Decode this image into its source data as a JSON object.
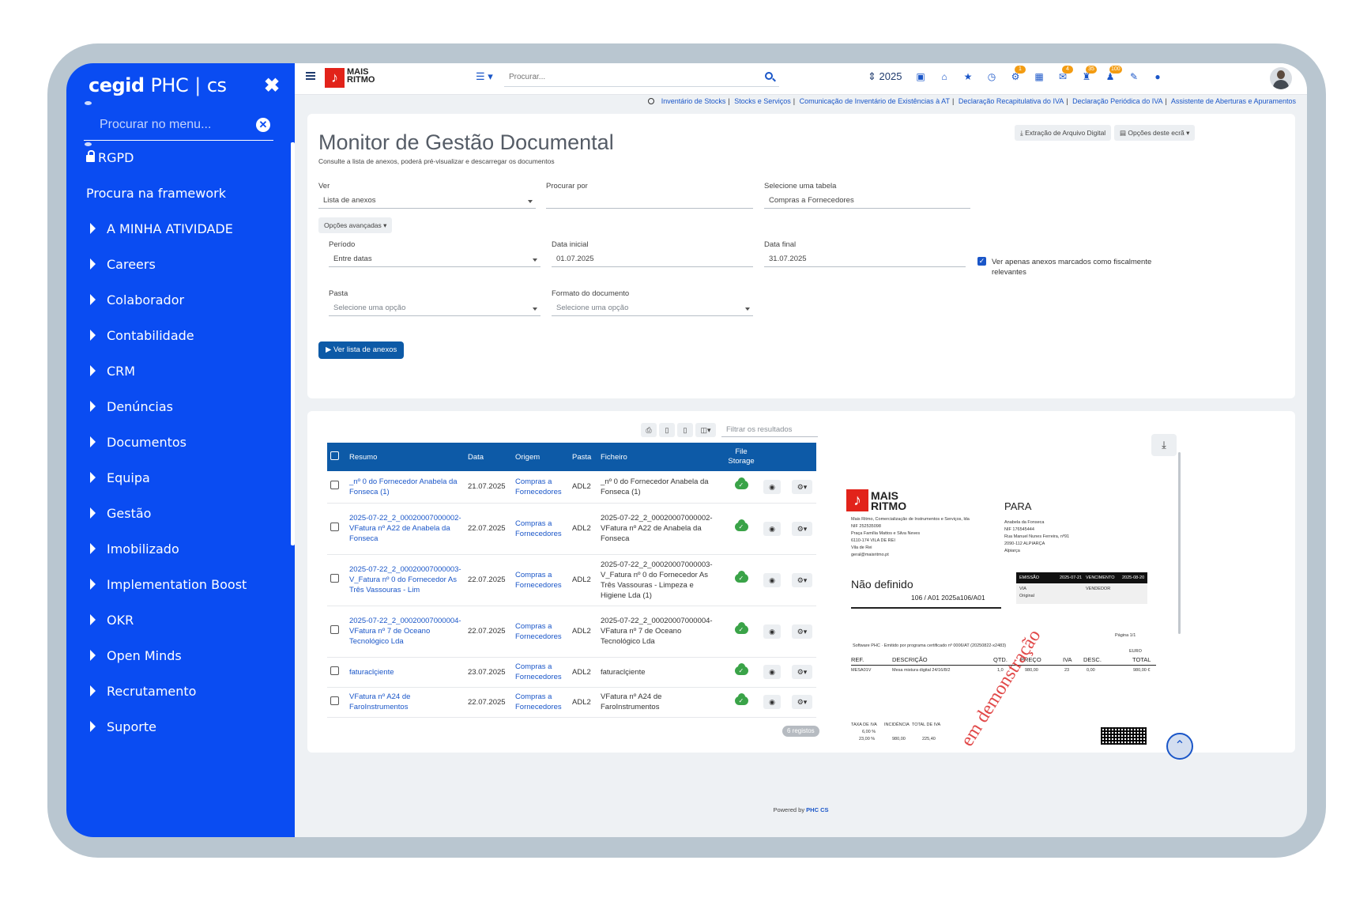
{
  "sidebar": {
    "brand": {
      "name": "cegid",
      "product": "PHC",
      "suffix": "CS"
    },
    "search_placeholder": "Procurar no menu...",
    "top_items": [
      "RGPD",
      "Procura na framework"
    ],
    "items": [
      "A MINHA ATIVIDADE",
      "Careers",
      "Colaborador",
      "Contabilidade",
      "CRM",
      "Denúncias",
      "Documentos",
      "Equipa",
      "Gestão",
      "Imobilizado",
      "Implementation Boost",
      "OKR",
      "Open Minds",
      "Recrutamento",
      "Suporte"
    ]
  },
  "topbar": {
    "logo_line1": "MAIS",
    "logo_line2": "RITMO",
    "search_placeholder": "Procurar...",
    "year": "2025",
    "badges": [
      "1",
      "4",
      "35",
      "100"
    ]
  },
  "breadcrumb": [
    "Inventário de Stocks",
    "Stocks e Serviços",
    "Comunicação de Inventário de Existências à AT",
    "Declaração Recapitulativa do IVA",
    "Declaração Periódica do IVA",
    "Assistente de Aberturas e Apuramentos"
  ],
  "page": {
    "title": "Monitor de Gestão Documental",
    "subtitle": "Consulte a lista de anexos, poderá pré-visualizar e descarregar os documentos",
    "btn_extract": "Extração de Arquivo Digital",
    "btn_options": "Opções deste ecrã"
  },
  "form": {
    "ver_label": "Ver",
    "ver_value": "Lista de anexos",
    "procurar_label": "Procurar por",
    "procurar_value": "",
    "tabela_label": "Selecione uma tabela",
    "tabela_value": "Compras a Fornecedores",
    "advanced_btn": "Opções avançadas",
    "periodo_label": "Período",
    "periodo_value": "Entre datas",
    "data_inicial_label": "Data inicial",
    "data_inicial_value": "01.07.2025",
    "data_final_label": "Data final",
    "data_final_value": "31.07.2025",
    "checkbox_label": "Ver apenas anexos marcados como fiscalmente relevantes",
    "pasta_label": "Pasta",
    "pasta_placeholder": "Selecione uma opção",
    "formato_label": "Formato do documento",
    "formato_placeholder": "Selecione uma opção",
    "submit_btn": "Ver lista de anexos"
  },
  "results": {
    "filter_placeholder": "Filtrar os resultados",
    "columns": [
      "Resumo",
      "Data",
      "Origem",
      "Pasta",
      "Ficheiro",
      "File Storage"
    ],
    "rows": [
      {
        "resumo": "_nº 0 do Fornecedor Anabela da Fonseca (1)",
        "data": "21.07.2025",
        "origem": "Compras a Fornecedores",
        "pasta": "ADL2",
        "ficheiro": "_nº 0 do Fornecedor Anabela da Fonseca (1)"
      },
      {
        "resumo": "2025-07-22_2_00020007000002-VFatura nº A22 de Anabela da Fonseca",
        "data": "22.07.2025",
        "origem": "Compras a Fornecedores",
        "pasta": "ADL2",
        "ficheiro": "2025-07-22_2_00020007000002-VFatura nº A22 de Anabela da Fonseca"
      },
      {
        "resumo": "2025-07-22_2_00020007000003-V_Fatura nº 0 do Fornecedor As Três Vassouras - Lim",
        "data": "22.07.2025",
        "origem": "Compras a Fornecedores",
        "pasta": "ADL2",
        "ficheiro": "2025-07-22_2_00020007000003-V_Fatura nº 0 do Fornecedor As Três Vassouras - Limpeza e Higiene Lda (1)"
      },
      {
        "resumo": "2025-07-22_2_00020007000004-VFatura nº 7 de Oceano Tecnológico Lda",
        "data": "22.07.2025",
        "origem": "Compras a Fornecedores",
        "pasta": "ADL2",
        "ficheiro": "2025-07-22_2_00020007000004-VFatura nº 7 de Oceano Tecnológico Lda"
      },
      {
        "resumo": "faturaclçiente",
        "data": "23.07.2025",
        "origem": "Compras a Fornecedores",
        "pasta": "ADL2",
        "ficheiro": "faturaclçiente"
      },
      {
        "resumo": "VFatura nº A24 de FaroInstrumentos",
        "data": "22.07.2025",
        "origem": "Compras a Fornecedores",
        "pasta": "ADL2",
        "ficheiro": "VFatura nº A24 de FaroInstrumentos"
      }
    ],
    "count_badge": "6 registos"
  },
  "preview": {
    "logo_line1": "MAIS",
    "logo_line2": "RITMO",
    "para": "PARA",
    "sender": [
      "Mais Ritmo, Comercialização de Instrumentos e Serviços, lda",
      "NIF 252535098",
      "Praça Família Mattos e Silva Neves",
      "6110-174 VILA DE REI",
      "Vila de Rei",
      "geral@maisritmo.pt"
    ],
    "receiver": [
      "Anabela da Fonseca",
      "NIF 176545444",
      "Rua Manuel Nunes Ferreira, nº91",
      "2090-112 ALPIARÇA",
      "Alpiarça"
    ],
    "doc_title": "Não definido",
    "doc_number": "106 / A01   2025a106/A01",
    "emissao_label": "EMISSÃO",
    "emissao_value": "2025-07-21",
    "vencimento_label": "VENCIMENTO",
    "vencimento_value": "2025-08-20",
    "via_label": "VIA",
    "via_value": "Original",
    "vendedor_label": "VENDEDOR",
    "pagina": "Página   1/1",
    "software": "Software PHC · Emitido por programa certificado nº 0006/AT (20250822-x2483)",
    "currency": "EURO",
    "headers": [
      "REF.",
      "DESCRIÇÃO",
      "QTD.",
      "PREÇO",
      "IVA",
      "DESC.",
      "TOTAL"
    ],
    "line": [
      "MESA01V",
      "Mesa mistura digital 24/16/8/2",
      "1,0",
      "980,00",
      "23",
      "0,00",
      "980,00 €"
    ],
    "tax_headers": [
      "TAXA DE IVA",
      "INCIDÊNCIA",
      "TOTAL DE IVA"
    ],
    "tax_rows": [
      [
        "6,00 %",
        "",
        ""
      ],
      [
        "23,00 %",
        "980,00",
        "225,40"
      ]
    ],
    "watermark": "em demonstração"
  },
  "footer": {
    "prefix": "Powered by",
    "brand": "PHC CS"
  }
}
